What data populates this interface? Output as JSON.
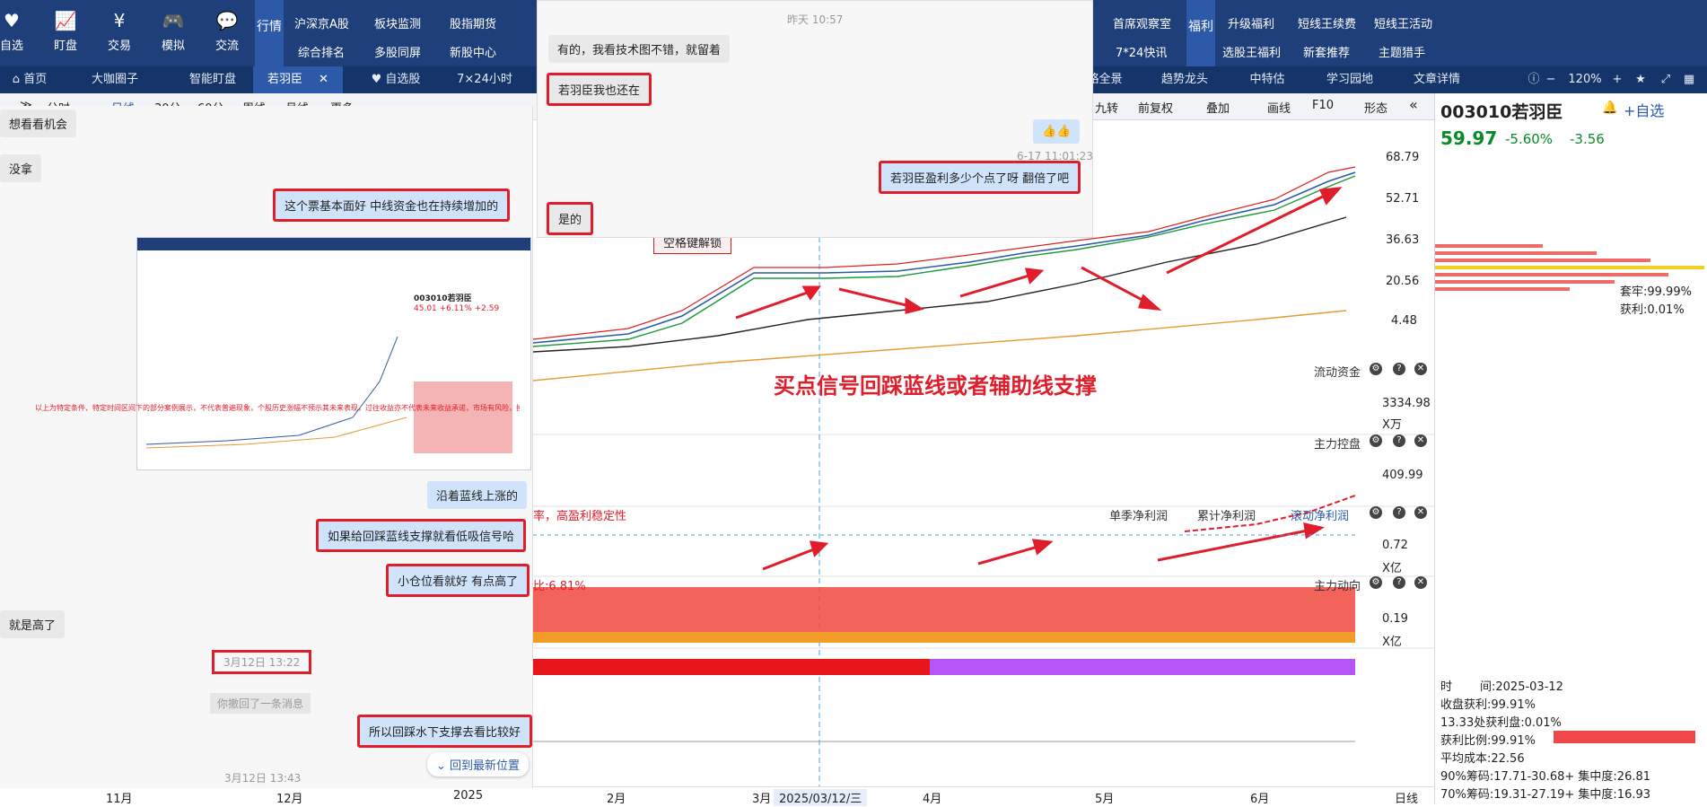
{
  "topbar": {
    "icons": [
      {
        "label": "自选",
        "icon": "heart-icon"
      },
      {
        "label": "盯盘",
        "icon": "chart-icon"
      },
      {
        "label": "交易",
        "icon": "yen-icon"
      },
      {
        "label": "模拟",
        "icon": "gamepad-icon"
      },
      {
        "label": "交流",
        "icon": "chat-icon"
      }
    ],
    "hq_label": "行情",
    "menu_row1": [
      "沪深京A股",
      "板块监测",
      "股指期货"
    ],
    "menu_row2": [
      "综合排名",
      "多股同屏",
      "新股中心"
    ],
    "right_row1": [
      "首席观察室",
      "升级福利",
      "短线王续费",
      "短线王活动"
    ],
    "right_row2": [
      "7*24快讯",
      "选股王福利",
      "新套推荐",
      "主题猎手"
    ],
    "fuli_label": "福利"
  },
  "tabs": [
    "首页",
    "大咖圈子",
    "智能盯盘",
    "若羽臣",
    "自选股",
    "7×24小时",
    "略全景",
    "趋势龙头",
    "中特估",
    "学习园地",
    "文章详情"
  ],
  "tab_zoom": "120%",
  "toolbar": {
    "left": [
      "分时",
      "日线",
      "30分",
      "60分",
      "周线",
      "月线",
      "更多"
    ],
    "right": [
      "九转",
      "前复权",
      "叠加",
      "画线",
      "F10",
      "形态"
    ]
  },
  "stock": {
    "code_name": "003010若羽臣",
    "price": "59.97",
    "change_pct": "-5.60%",
    "change": "-3.56",
    "add_label": "自选"
  },
  "price_axis": [
    "68.79",
    "52.71",
    "36.63",
    "20.56",
    "4.48"
  ],
  "panels": {
    "liquid": {
      "title": "流动资金",
      "value": "3334.98",
      "unit": "X万"
    },
    "main_ctrl": {
      "title": "主力控盘",
      "value": "409.99"
    },
    "profit": {
      "title_left": "率，高盈利稳定性",
      "tabs": [
        "单季净利润",
        "累计净利润",
        "滚动净利润"
      ],
      "value": "0.72",
      "unit": "X亿"
    },
    "main_move": {
      "title": "主力动向",
      "left": "比:6.81%",
      "value": "0.19",
      "unit": "X亿"
    }
  },
  "annotation": "买点信号回踩蓝线或者辅助线支撑",
  "tooltip_btn": "空格键解锁",
  "xaxis": [
    "11月",
    "12月",
    "2025",
    "2月",
    "3月",
    "2025/03/12/三",
    "4月",
    "5月",
    "6月",
    "日线"
  ],
  "chip": {
    "taolao": "套牢:99.99%",
    "huoli": "获利:0.01%",
    "time_label": "时",
    "time": "间:2025-03-12",
    "lines": [
      "收盘获利:99.91%",
      "13.33处获利盘:0.01%",
      "获利比例:99.91%",
      "平均成本:22.56",
      "90%筹码:17.71-30.68+ 集中度:26.81",
      "70%筹码:19.31-27.19+ 集中度:16.93"
    ]
  },
  "chat_left": {
    "msgs": [
      {
        "text": "想看看机会",
        "me": false
      },
      {
        "text": "没拿",
        "me": false
      },
      {
        "text": "这个票基本面好   中线资金也在持续增加的",
        "me": true
      },
      {
        "text": "沿着蓝线上涨的",
        "me": true
      },
      {
        "text": "如果给回踩蓝线支撑就看低吸信号哈",
        "me": true
      },
      {
        "text": "小仓位看就好  有点高了",
        "me": true
      },
      {
        "text": "就是高了",
        "me": false
      },
      {
        "text": "3月12日 13:22",
        "me": false
      },
      {
        "text": "你撤回了一条消息",
        "me": false
      },
      {
        "text": "所以回踩水下支撑去看比较好",
        "me": true
      },
      {
        "text": "3月12日 13:43",
        "me": false
      }
    ],
    "back_latest": "回到最新位置",
    "mini_disclaimer": "以上为特定条件、特定时间区间下的部分案例展示，不代表普遍现象，个股历史涨幅不预示其未来表现，过往收益亦不代表未来收益承诺，市场有风险，投资需谨慎！",
    "mini_stock": "003010若羽臣",
    "mini_price": "45.01 +6.11% +2.59"
  },
  "chat_top": {
    "time1": "昨天 10:57",
    "msg1": "有的，我看技术图不错，就留着",
    "msg2": "若羽臣我也还在",
    "time2": "6-17 11:01:23",
    "msg3": "若羽臣盈利多少个点了呀  翻倍了吧",
    "msg4": "是的"
  },
  "colors": {
    "accent": "#1f3f7a",
    "up": "#e01e2b",
    "down": "#0a8a2a"
  }
}
